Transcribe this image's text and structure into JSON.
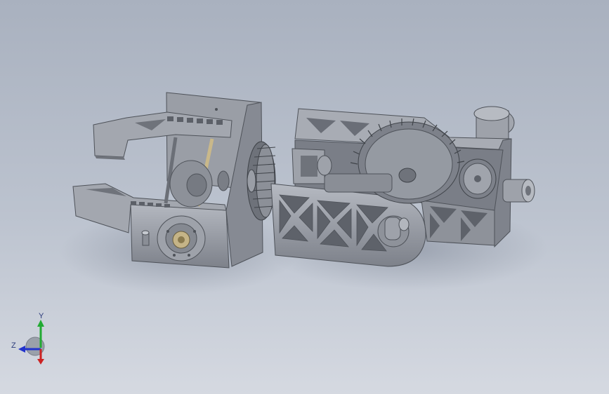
{
  "view": {
    "background_top": "#a9b1bf",
    "background_bottom": "#d5d9e1",
    "part_color": "#8f939c",
    "part_light": "#b4b8c0",
    "part_dark": "#5f636b"
  },
  "triad": {
    "y_label": "Y",
    "z_label": "Z",
    "x_color": "#cc2222",
    "y_color": "#22aa33",
    "z_color": "#2233cc"
  }
}
